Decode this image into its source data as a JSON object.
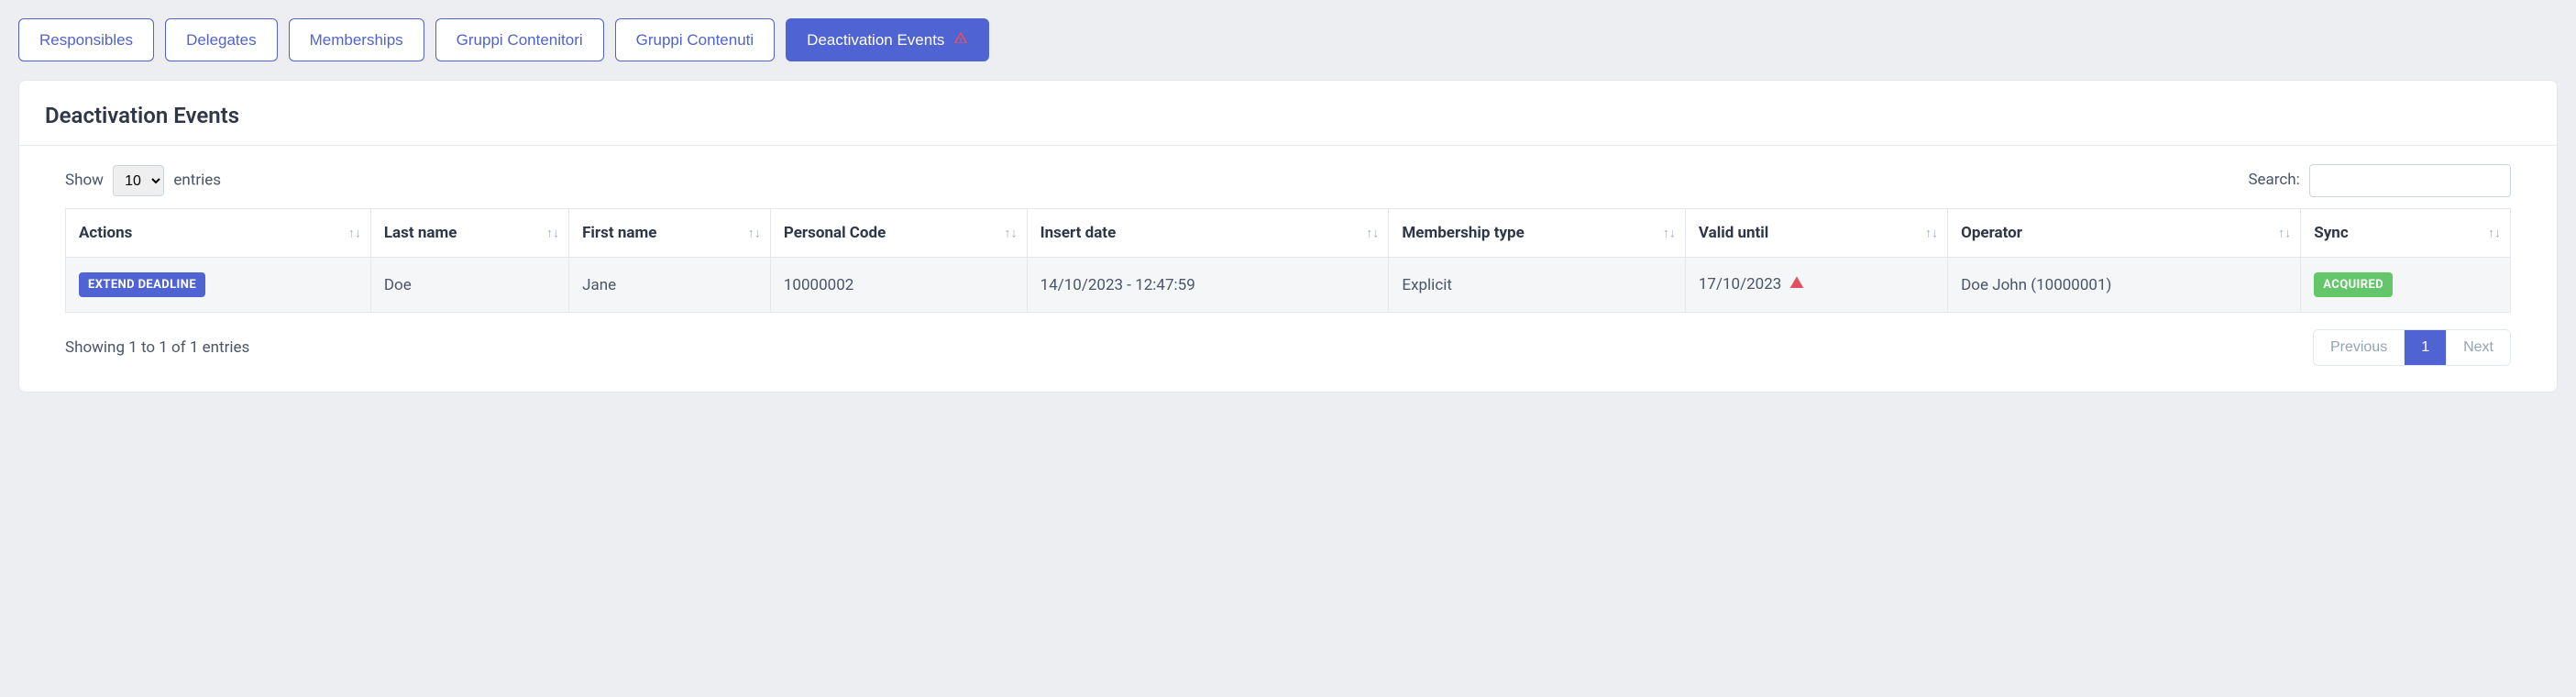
{
  "tabs": [
    {
      "label": "Responsibles",
      "active": false
    },
    {
      "label": "Delegates",
      "active": false
    },
    {
      "label": "Memberships",
      "active": false
    },
    {
      "label": "Gruppi Contenitori",
      "active": false
    },
    {
      "label": "Gruppi Contenuti",
      "active": false
    },
    {
      "label": "Deactivation Events",
      "active": true,
      "warn": true
    }
  ],
  "panel": {
    "title": "Deactivation Events"
  },
  "length": {
    "show_label": "Show",
    "entries_label": "entries",
    "value": "10"
  },
  "search": {
    "label": "Search:",
    "value": ""
  },
  "columns": [
    "Actions",
    "Last name",
    "First name",
    "Personal Code",
    "Insert date",
    "Membership type",
    "Valid until",
    "Operator",
    "Sync"
  ],
  "rows": [
    {
      "action_label": "EXTEND DEADLINE",
      "last_name": "Doe",
      "first_name": "Jane",
      "personal_code": "10000002",
      "insert_date": "14/10/2023 - 12:47:59",
      "membership_type": "Explicit",
      "valid_until": "17/10/2023",
      "valid_until_warn": true,
      "operator": "Doe John (10000001)",
      "sync_label": "ACQUIRED"
    }
  ],
  "info": "Showing 1 to 1 of 1 entries",
  "pagination": {
    "previous": "Previous",
    "next": "Next",
    "pages": [
      "1"
    ],
    "active": "1"
  },
  "colors": {
    "primary": "#4f63d2",
    "success": "#63c76a",
    "danger": "#e05260"
  }
}
